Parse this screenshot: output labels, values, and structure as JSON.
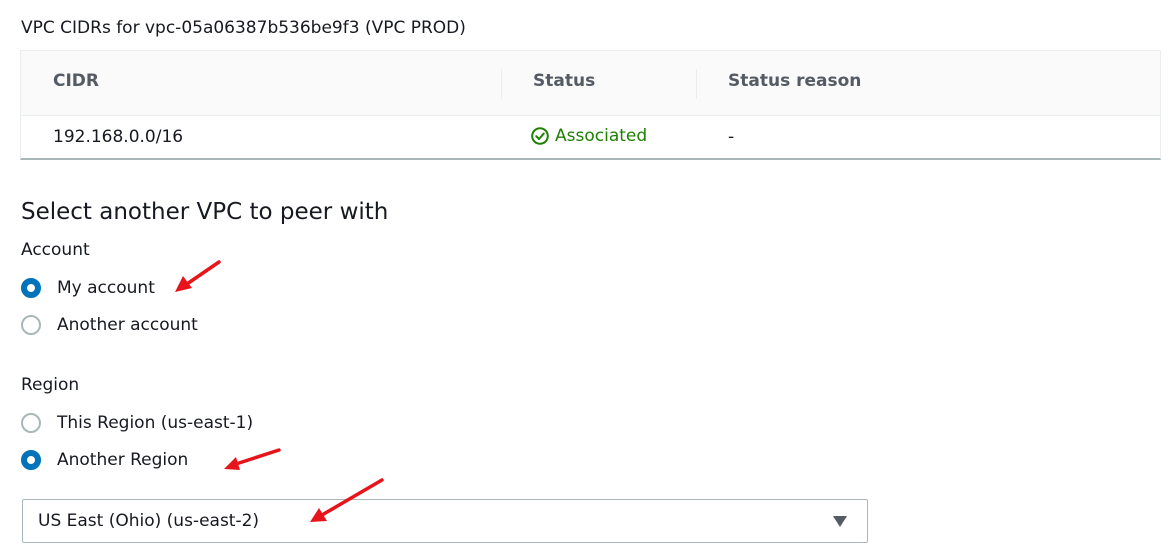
{
  "caption": "VPC CIDRs for vpc-05a06387b536be9f3 (VPC PROD)",
  "cidr_table": {
    "columns": [
      "CIDR",
      "Status",
      "Status reason"
    ],
    "rows": [
      {
        "cidr": "192.168.0.0/16",
        "status": "Associated",
        "status_reason": "-"
      }
    ]
  },
  "peer_section": {
    "heading": "Select another VPC to peer with",
    "account": {
      "label": "Account",
      "options": [
        {
          "label": "My account",
          "checked": true
        },
        {
          "label": "Another account",
          "checked": false
        }
      ]
    },
    "region": {
      "label": "Region",
      "options": [
        {
          "label": "This Region (us-east-1)",
          "checked": false
        },
        {
          "label": "Another Region",
          "checked": true
        }
      ],
      "select_value": "US East (Ohio) (us-east-2)"
    }
  },
  "icons": {
    "status_icon": "check-circle-icon",
    "select_icon": "caret-down-icon",
    "annotation_icon": "red-arrow-icon"
  },
  "colors": {
    "accent": "#0073bb",
    "success": "#1d8102",
    "annotation": "#e8141b"
  }
}
